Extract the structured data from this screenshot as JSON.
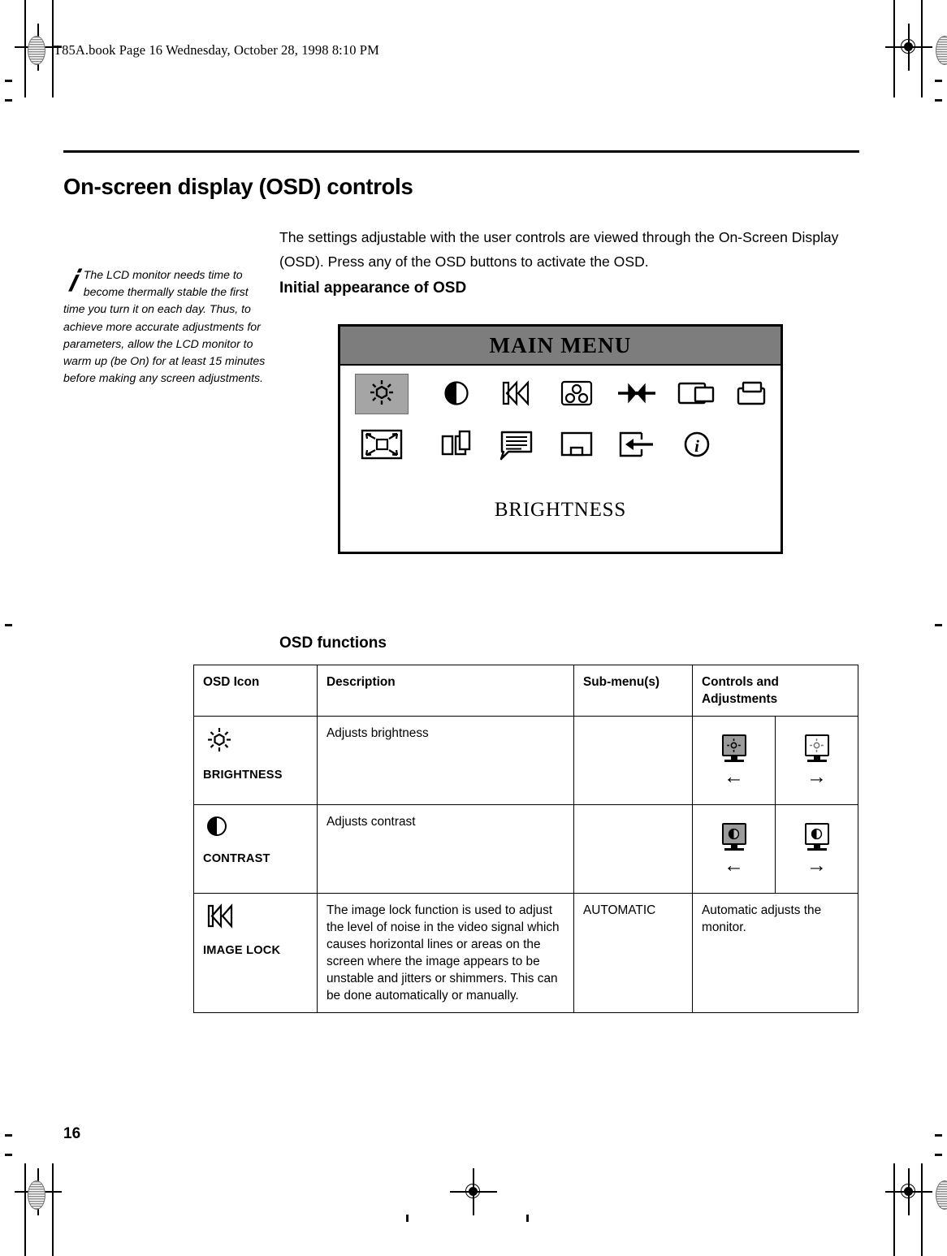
{
  "book_header": "T85A.book  Page 16  Wednesday, October 28, 1998  8:10 PM",
  "page_number": "16",
  "page_title": "On-screen display (OSD) controls",
  "intro": "The settings adjustable with the user controls are viewed through the On-Screen Display (OSD). Press any of the OSD buttons to activate the OSD.",
  "subheads": {
    "initial_appearance": "Initial appearance of OSD",
    "osd_functions": "OSD functions"
  },
  "note": {
    "icon": "info-italic-i",
    "text": "The LCD monitor needs time to become thermally stable the first time you turn it on each day. Thus, to achieve more accurate adjustments for parameters, allow the LCD monitor to warm up (be On) for at least 15 minutes before making any screen adjustments."
  },
  "osd_screen": {
    "title": "MAIN MENU",
    "selected_label": "BRIGHTNESS",
    "title_bar_color": "#7d7d7d",
    "selection_color": "#a5a5a5",
    "icons_row1": [
      "brightness-sun-icon",
      "contrast-half-circle-icon",
      "image-lock-chevron-icon",
      "color-three-circles-icon",
      "horizontal-position-arrows-icon",
      "size-overlapping-rects-icon",
      "vertical-position-icon"
    ],
    "icons_row2": [
      "scaling-four-arrows-icon",
      "side-panels-icon",
      "language-speech-bubble-icon",
      "osd-position-icon",
      "exit-arrow-icon",
      "information-circle-i-icon"
    ]
  },
  "table": {
    "headers": {
      "icon": "OSD Icon",
      "description": "Description",
      "submenu": "Sub-menu(s)",
      "controls": "Controls and Adjustments"
    },
    "rows": [
      {
        "icon_name": "brightness-sun-icon",
        "icon_label": "BRIGHTNESS",
        "description": "Adjusts brightness",
        "submenu": "",
        "controls_left": {
          "icon": "monitor-dim-icon",
          "arrow": "←"
        },
        "controls_right": {
          "icon": "monitor-bright-icon",
          "arrow": "→"
        }
      },
      {
        "icon_name": "contrast-half-circle-icon",
        "icon_label": "CONTRAST",
        "description": "Adjusts contrast",
        "submenu": "",
        "controls_left": {
          "icon": "monitor-low-contrast-icon",
          "arrow": "←"
        },
        "controls_right": {
          "icon": "monitor-high-contrast-icon",
          "arrow": "→"
        }
      },
      {
        "icon_name": "image-lock-chevron-icon",
        "icon_label": "IMAGE LOCK",
        "description": "The image lock function is used to adjust the level of noise in the video signal which causes horizontal lines or areas on the screen where the image appears to be unstable and jitters or shimmers. This can be done automatically or manually.",
        "submenu": "AUTOMATIC",
        "controls_text": "Automatic adjusts the monitor."
      }
    ]
  }
}
